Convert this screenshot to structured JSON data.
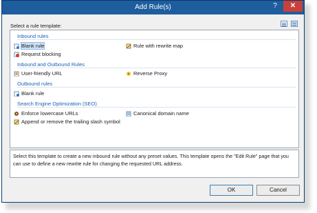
{
  "window": {
    "title": "Add Rule(s)",
    "help_glyph": "?",
    "close_glyph": "✕"
  },
  "select_label": "Select a rule template:",
  "groups": [
    {
      "header": "Inbound rules",
      "items": [
        {
          "label": "Blank rule",
          "icon": "blank-rule-icon"
        },
        {
          "label": "Rule with rewrite map",
          "icon": "rewrite-map-icon"
        },
        {
          "label": "Request blocking",
          "icon": "request-blocking-icon"
        }
      ]
    },
    {
      "header": "Inbound and Outbound Rules",
      "items": [
        {
          "label": "User-friendly URL",
          "icon": "user-friendly-url-icon"
        },
        {
          "label": "Reverse Proxy",
          "icon": "reverse-proxy-icon"
        }
      ]
    },
    {
      "header": "Outbound rules",
      "items": [
        {
          "label": "Blank rule",
          "icon": "blank-rule-icon"
        }
      ]
    },
    {
      "header": "Search Engine Optimization (SEO)",
      "items": [
        {
          "label": "Enforce lowercase URLs",
          "icon": "lowercase-urls-icon"
        },
        {
          "label": "Canonical domain name",
          "icon": "canonical-domain-icon"
        },
        {
          "label": "Append or remove the trailing slash symbol",
          "icon": "trailing-slash-icon"
        }
      ]
    }
  ],
  "description": "Select this template to create a new inbound rule without any preset values. This template opens the \"Edit Rule\" page that you can use to define a new rewrite rule for changing the requested URL address.",
  "buttons": {
    "ok": "OK",
    "cancel": "Cancel"
  }
}
